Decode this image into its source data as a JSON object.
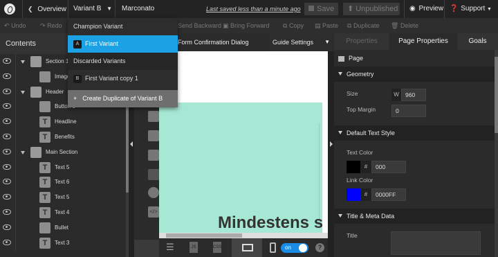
{
  "topbar": {
    "back_label": "Overview",
    "variant_label": "Variant B",
    "page_name": "Marconato",
    "last_saved": "Last saved  less than a minute ago",
    "save_label": "Save",
    "unpublished_label": "Unpublished",
    "preview_label": "Preview",
    "support_label": "Support"
  },
  "toolbar": {
    "undo": "Undo",
    "redo": "Redo",
    "send_backward": "Send Backward",
    "bring_forward": "Bring Forward",
    "copy": "Copy",
    "paste": "Paste",
    "duplicate": "Duplicate",
    "delete": "Delete"
  },
  "variant_menu": {
    "champion_header": "Champion Variant",
    "active_badge": "A",
    "active_label": "First Variant",
    "discarded_header": "Discarded Variants",
    "discarded_badge": "B",
    "discarded_label": "First Variant copy 1",
    "create_label": "Create Duplicate of Variant B"
  },
  "contents": {
    "title": "Contents",
    "rows": [
      {
        "label": "Section 1"
      },
      {
        "label": "Image"
      },
      {
        "label": "Header"
      },
      {
        "label": "Button 1"
      },
      {
        "label": "Headline"
      },
      {
        "label": "Benefits"
      },
      {
        "label": "Main Section"
      },
      {
        "label": "Text 5"
      },
      {
        "label": "Text 6"
      },
      {
        "label": "Text 5"
      },
      {
        "label": "Text 4"
      },
      {
        "label": "Bullet"
      },
      {
        "label": "Text 3"
      }
    ]
  },
  "canvas": {
    "tab_form": "Form Confirmation Dialog",
    "tab_guide": "Guide Settings",
    "headline": "Mindestens s",
    "toggle_label": "on",
    "bg_color": "#a7e8d4"
  },
  "right_panel": {
    "tab_properties": "Properties",
    "tab_page_properties": "Page Properties",
    "tab_goals": "Goals",
    "page_label": "Page",
    "geometry_title": "Geometry",
    "size_label": "Size",
    "w_label": "W",
    "width_value": "960",
    "top_margin_label": "Top Margin",
    "top_margin_value": "0",
    "text_style_title": "Default Text Style",
    "text_color_label": "Text Color",
    "text_color_value": "000",
    "text_color_hex": "#000000",
    "link_color_label": "Link Color",
    "link_color_value": "0000FF",
    "link_color_hex": "#0000ff",
    "meta_title": "Title & Meta Data",
    "title_label": "Title",
    "hash": "#"
  }
}
